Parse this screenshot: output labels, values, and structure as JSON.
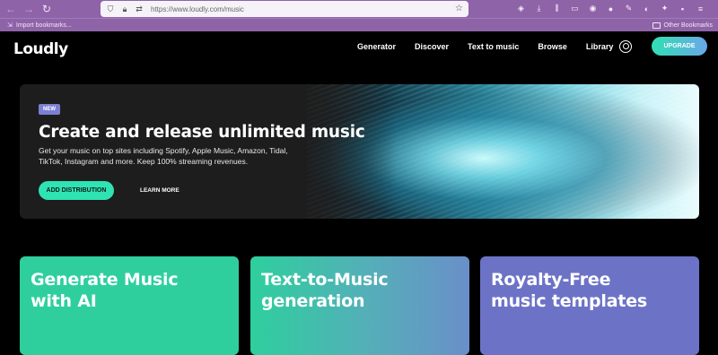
{
  "browser": {
    "url": "https://www.loudly.com/music",
    "bookmark_import": "Import bookmarks...",
    "other_bookmarks": "Other Bookmarks"
  },
  "site": {
    "logo": "Loudly",
    "nav": [
      "Generator",
      "Discover",
      "Text to music",
      "Browse",
      "Library"
    ],
    "upgrade": "UPGRADE"
  },
  "hero": {
    "badge": "NEW",
    "title": "Create and release unlimited music",
    "description": "Get your music on top sites including Spotify, Apple Music, Amazon, Tidal, TikTok, Instagram and more. Keep 100% streaming revenues.",
    "primary_button": "ADD DISTRIBUTION",
    "secondary_link": "LEARN MORE"
  },
  "cards": [
    {
      "title_line1": "Generate Music",
      "title_line2": "with AI"
    },
    {
      "title_line1": "Text-to-Music",
      "title_line2": "generation"
    },
    {
      "title_line1": "Royalty-Free",
      "title_line2": "music templates"
    }
  ],
  "colors": {
    "accent": "#2fe3b3",
    "browser_chrome": "#8f63a8",
    "card_purple": "#6c73c6"
  }
}
